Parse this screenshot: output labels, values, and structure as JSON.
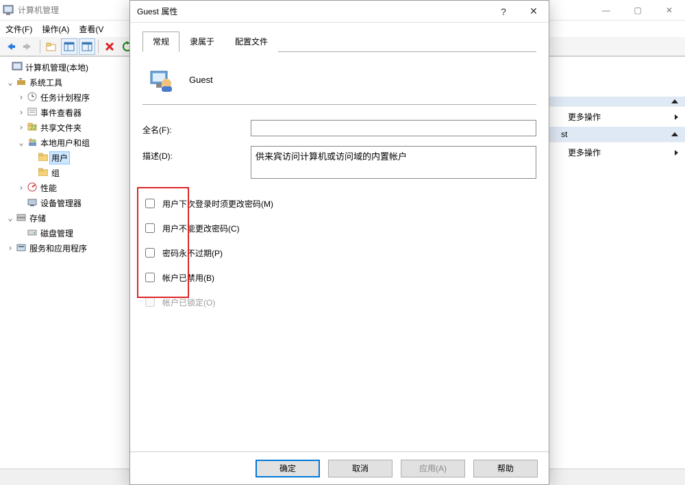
{
  "mainWindow": {
    "title": "计算机管理",
    "menu": {
      "file": "文件(F)",
      "action": "操作(A)",
      "view": "查看(V"
    }
  },
  "tree": {
    "root": "计算机管理(本地)",
    "systools": "系统工具",
    "task": "任务计划程序",
    "event": "事件查看器",
    "share": "共享文件夹",
    "localusers": "本地用户和组",
    "users": "用户",
    "groups": "组",
    "perf": "性能",
    "devmgr": "设备管理器",
    "storage": "存储",
    "disk": "磁盘管理",
    "services": "服务和应用程序"
  },
  "actions": {
    "more1": "更多操作",
    "head2": "st",
    "more2": "更多操作"
  },
  "dialog": {
    "title": "Guest 属性",
    "tabs": {
      "general": "常规",
      "memberOf": "隶属于",
      "profile": "配置文件"
    },
    "userName": "Guest",
    "fullNameLabel": "全名(F):",
    "fullNameValue": "",
    "descLabel": "描述(D):",
    "descValue": "供来宾访问计算机或访问域的内置帐户",
    "chk1": "用户下次登录时须更改密码(M)",
    "chk2": "用户不能更改密码(C)",
    "chk3": "密码永不过期(P)",
    "chk4": "帐户已禁用(B)",
    "chk5": "帐户已锁定(O)",
    "ok": "确定",
    "cancel": "取消",
    "apply": "应用(A)",
    "help": "帮助"
  }
}
